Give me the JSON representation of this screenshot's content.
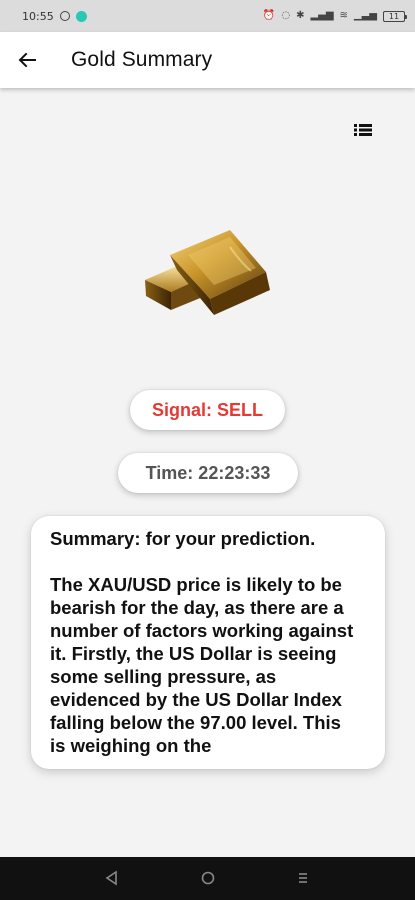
{
  "status_bar": {
    "time": "10:55",
    "battery_level": "11"
  },
  "header": {
    "title": "Gold Summary"
  },
  "signal": {
    "label": "Signal: SELL",
    "color": "#e53935"
  },
  "time": {
    "label": "Time: 22:23:33"
  },
  "summary": {
    "heading": "Summary: for your prediction.",
    "body": "The XAU/USD price is likely to be\nbearish for the day, as there are a\nnumber of factors working against\nit. Firstly, the US Dollar is seeing\nsome selling pressure, as\nevidenced by the US Dollar Index\nfalling below the 97.00 level. This\nis weighing on the"
  },
  "icons": {
    "back": "arrow-left-icon",
    "menu": "list-icon",
    "hero": "gold-bars-icon",
    "nav_back": "triangle-back-icon",
    "nav_home": "circle-home-icon",
    "nav_recents": "lines-recents-icon"
  }
}
